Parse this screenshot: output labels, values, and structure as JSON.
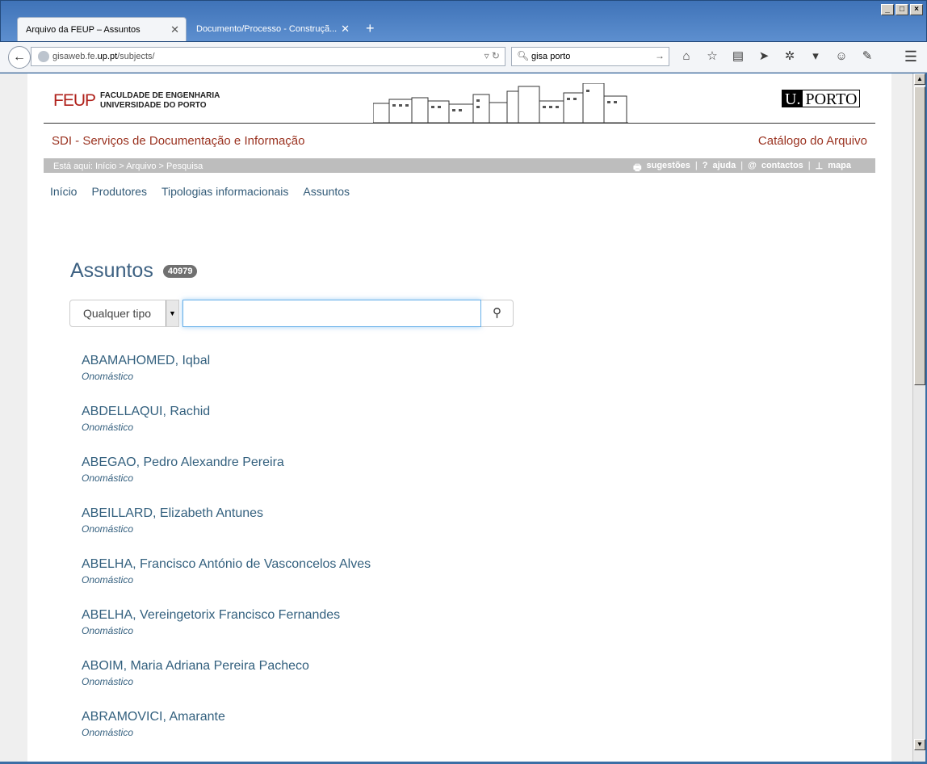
{
  "browser": {
    "tabs": [
      {
        "label": "Arquivo da FEUP – Assuntos"
      },
      {
        "label": "Documento/Processo - Construçã..."
      }
    ],
    "url": {
      "prefix": "gisaweb.fe.",
      "host": "up.pt",
      "path": "/subjects/"
    },
    "search_value": "gisa porto"
  },
  "site": {
    "feup_mark": "FEUP",
    "feup_line1": "FACULDADE DE ENGENHARIA",
    "feup_line2": "UNIVERSIDADE DO PORTO",
    "uporto_u": "U.",
    "uporto_p": "PORTO",
    "sdi_title": "SDI - Serviços de Documentação e Informação",
    "catalog_title": "Catálogo do Arquivo",
    "breadcrumb": "Está aqui: Início > Arquivo > Pesquisa",
    "toplinks": {
      "suggestions": "sugestões",
      "help": "ajuda",
      "contacts": "contactos",
      "map": "mapa"
    }
  },
  "nav": [
    "Início",
    "Produtores",
    "Tipologias informacionais",
    "Assuntos"
  ],
  "main": {
    "heading": "Assuntos",
    "count": "40979",
    "type_filter": "Qualquer tipo",
    "search_value": "",
    "results": [
      {
        "name": "ABAMAHOMED, Iqbal",
        "type": "Onomástico"
      },
      {
        "name": "ABDELLAQUI, Rachid",
        "type": "Onomástico"
      },
      {
        "name": "ABEGAO, Pedro Alexandre Pereira",
        "type": "Onomástico"
      },
      {
        "name": "ABEILLARD, Elizabeth Antunes",
        "type": "Onomástico"
      },
      {
        "name": "ABELHA, Francisco António de Vasconcelos Alves",
        "type": "Onomástico"
      },
      {
        "name": "ABELHA, Vereingetorix Francisco Fernandes",
        "type": "Onomástico"
      },
      {
        "name": "ABOIM, Maria Adriana Pereira Pacheco",
        "type": "Onomástico"
      },
      {
        "name": "ABRAMOVICI, Amarante",
        "type": "Onomástico"
      }
    ]
  },
  "colors": {
    "brand_red": "#9a3220",
    "link_blue": "#33607e",
    "header_gray": "#bdbdbd"
  }
}
